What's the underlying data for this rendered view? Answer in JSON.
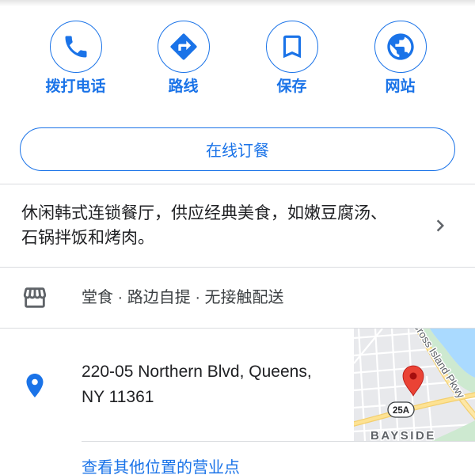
{
  "actions": [
    {
      "label": "拨打电话",
      "icon": "phone-icon"
    },
    {
      "label": "路线",
      "icon": "directions-icon"
    },
    {
      "label": "保存",
      "icon": "bookmark-icon"
    },
    {
      "label": "网站",
      "icon": "globe-icon"
    }
  ],
  "order_online": {
    "label": "在线订餐"
  },
  "description": {
    "lines": [
      "休闲韩式连锁餐厅，供应经典美食，如嫩豆腐汤、",
      "石锅拌饭和烤肉。"
    ],
    "icon": "chevron-right-icon"
  },
  "service_options": {
    "text": "堂食 · 路边自提 · 无接触配送",
    "icon": "storefront-icon"
  },
  "address": {
    "lines": [
      "220-05 Northern Blvd, Queens,",
      "NY 11361"
    ],
    "icon": "place-icon"
  },
  "map": {
    "road_label": "Cross Island Pkwy",
    "route_shield": "25A",
    "area_label": "BAYSIDE",
    "pin_icon": "map-pin-icon"
  },
  "other_locations": {
    "label": "查看其他位置的营业点"
  },
  "colors": {
    "accent": "#1a73e8",
    "text": "#202124",
    "text_secondary": "#3c4043",
    "icon_gray": "#5f6368",
    "divider": "#dadce0",
    "pin": "#ea4335"
  }
}
